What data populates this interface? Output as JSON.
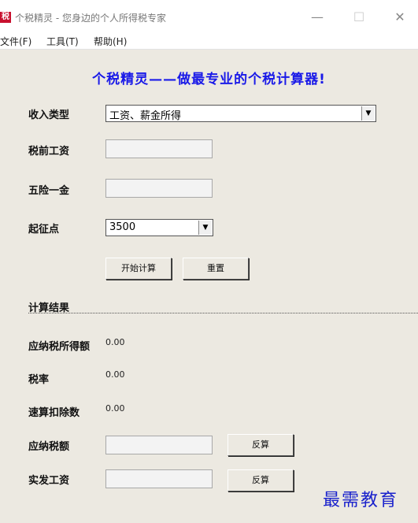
{
  "window": {
    "app_icon_text": "税",
    "title": "个税精灵 - 您身边的个人所得税专家",
    "min_glyph": "—",
    "max_glyph": "☐",
    "close_glyph": "✕"
  },
  "menu": {
    "file": "文件(F)",
    "tools": "工具(T)",
    "help": "帮助(H)"
  },
  "headline": "个税精灵——做最专业的个税计算器!",
  "form": {
    "income_type_label": "收入类型",
    "income_type_value": "工资、薪金所得",
    "pretax_salary_label": "税前工资",
    "pretax_salary_value": "",
    "insurance_label": "五险一金",
    "insurance_value": "",
    "threshold_label": "起征点",
    "threshold_value": "3500",
    "calculate_button": "开始计算",
    "reset_button": "重置"
  },
  "results": {
    "section_title": "计算结果",
    "taxable_income_label": "应纳税所得额",
    "taxable_income_value": "0.00",
    "tax_rate_label": "税率",
    "tax_rate_value": "0.00",
    "quick_deduction_label": "速算扣除数",
    "quick_deduction_value": "0.00",
    "tax_payable_label": "应纳税额",
    "tax_payable_value": "",
    "tax_payable_reverse_button": "反算",
    "net_salary_label": "实发工资",
    "net_salary_value": "",
    "net_salary_reverse_button": "反算"
  },
  "watermark": "最需教育",
  "icons": {
    "dropdown_arrow": "▼"
  },
  "colors": {
    "headline": "#1a1ae8",
    "app_icon": "#c8102e",
    "watermark": "#1a22cc"
  }
}
